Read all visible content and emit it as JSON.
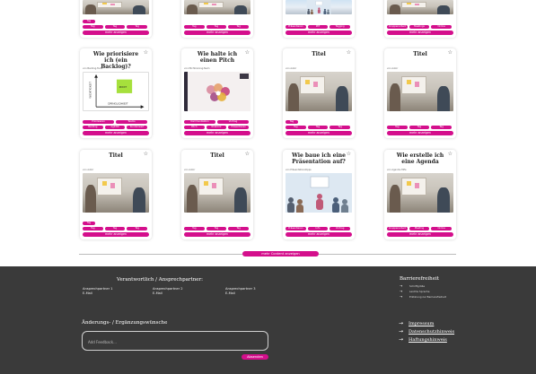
{
  "cards": [
    {
      "id": "c1",
      "title": "",
      "author": "",
      "thumb": "meeting",
      "tags": [
        "Tag",
        "Tag",
        "Tag",
        "Tag"
      ],
      "more": "mehr anzeigen"
    },
    {
      "id": "c2",
      "title": "",
      "author": "",
      "thumb": "meeting",
      "tags": [
        "Tag",
        "Tag",
        "Tag"
      ],
      "more": "mehr anzeigen"
    },
    {
      "id": "c3",
      "title": "",
      "author": "",
      "thumb": "pres",
      "tags": [
        "Präsentieren",
        "MIT",
        "Tagging"
      ],
      "more": "mehr anzeigen"
    },
    {
      "id": "c4",
      "title": "",
      "author": "",
      "thumb": "meeting",
      "tags": [
        "Gruppenarbeit",
        "Meetings",
        "Online"
      ],
      "more": "mehr anzeigen"
    },
    {
      "id": "c5",
      "title": "Wie priorisiere ich (ein Backlog)?",
      "author": "von Backlog-Tools",
      "thumb": "backlog",
      "tags": [
        "Priorisieren",
        "Teams",
        "Backlog",
        "Agilität",
        "Kundenwert"
      ],
      "more": "mehr anzeigen"
    },
    {
      "id": "c6",
      "title": "Wie halte ich einen Pitch",
      "author": "von Pitchtraining-Team",
      "thumb": "pitch",
      "tags": [
        "Kommunikation",
        "Vortrag",
        "Pitch",
        "Rhetorik",
        "Präsentieren"
      ],
      "more": "mehr anzeigen"
    },
    {
      "id": "c7",
      "title": "Titel",
      "author": "von Autor",
      "thumb": "meeting",
      "tags": [
        "Tag",
        "Tag",
        "Tag",
        "Tag"
      ],
      "more": "mehr anzeigen"
    },
    {
      "id": "c8",
      "title": "Titel",
      "author": "von Autor",
      "thumb": "meeting",
      "tags": [
        "Tag",
        "Tag",
        "Tag"
      ],
      "more": "mehr anzeigen"
    },
    {
      "id": "c9",
      "title": "Titel",
      "author": "von Autor",
      "thumb": "meeting",
      "tags": [
        "Tag",
        "Tag",
        "Tag",
        "Tag"
      ],
      "more": "mehr anzeigen"
    },
    {
      "id": "c10",
      "title": "Titel",
      "author": "von Autor",
      "thumb": "meeting",
      "tags": [
        "Tag",
        "Tag",
        "Tag"
      ],
      "more": "mehr anzeigen"
    },
    {
      "id": "c11",
      "title": "Wie baue ich eine Präsentation auf?",
      "author": "von Präsentationstipps",
      "thumb": "pres",
      "tags": [
        "Präsentieren",
        "Info",
        "Vortrag"
      ],
      "more": "mehr anzeigen"
    },
    {
      "id": "c12",
      "title": "Wie erstelle ich eine Agenda",
      "author": "von Agenda-Hilfe",
      "thumb": "meeting",
      "tags": [
        "Gruppenarbeit",
        "Meeting",
        "Online"
      ],
      "more": "mehr anzeigen"
    }
  ],
  "backlog_chart": {
    "ylabel": "WICHTIGKEIT",
    "xlabel": "DRINGLICHKEIT",
    "note": "#DOIT"
  },
  "load_more": "mehr Content anzeigen",
  "footer": {
    "contacts_title": "Verantwortlich / Ansprechpartner:",
    "contacts": [
      {
        "name": "Ansprechpartner 1",
        "mail": "E-Mail"
      },
      {
        "name": "Ansprechpartner 2",
        "mail": "E-Mail"
      },
      {
        "name": "Ansprechpartner 3",
        "mail": "E-Mail"
      }
    ],
    "feedback_title": "Änderungs- / Ergänzungswünsche",
    "feedback_placeholder": "Add Feedback...",
    "submit": "Absenden",
    "accessibility_title": "Barrierefreiheit",
    "accessibility_links": [
      "Schriftgröße",
      "Leichte Sprache",
      "Erklärung zur Barrierefreiheit"
    ],
    "legal_links": [
      "Impressum",
      "Datenschutzhinweis",
      "Haftungshinweis"
    ]
  },
  "colors": {
    "accent": "#d40f8c",
    "footer_bg": "#3a3a3a"
  }
}
